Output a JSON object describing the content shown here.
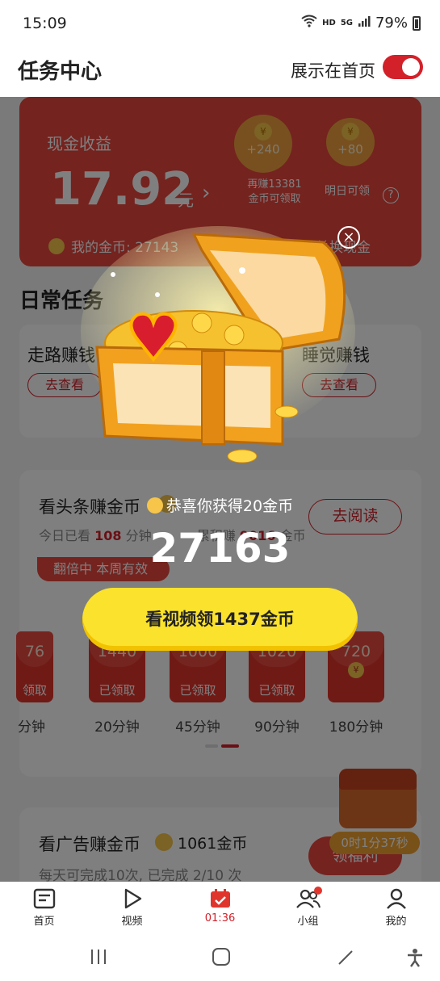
{
  "status_bar": {
    "time": "15:09",
    "network": "HD",
    "signal": "5G",
    "battery": "79%"
  },
  "header": {
    "title": "任务中心",
    "show_on_home_label": "展示在首页",
    "show_on_home_on": true
  },
  "cash_card": {
    "title": "现金收益",
    "amount": "17.92",
    "unit": "元",
    "badge_240": "+240",
    "earn_more": "再赚13381金币可领取",
    "badge_80": "+80",
    "tomorrow": "明日可领",
    "help": "?",
    "my_coins": "我的金币: 27143",
    "auto_exchange": "夜自动兑换现金"
  },
  "daily": {
    "title": "日常任务",
    "walk_title": "走路赚钱",
    "walk_btn": "去查看",
    "sleep_title": "睡觉赚钱",
    "sleep_btn": "去查看"
  },
  "read_card": {
    "title": "看头条赚金币",
    "go_btn": "去阅读",
    "today_label": "今日已看",
    "today_value": "108",
    "today_unit": "分钟",
    "total_label": "累积赚",
    "total_value": "9016",
    "total_unit": "金币",
    "double_tag": "翻倍中 本周有效",
    "envelopes": [
      {
        "value": "76",
        "label": "领取",
        "time": "分钟"
      },
      {
        "value": "1440",
        "label": "已领取",
        "time": "20分钟"
      },
      {
        "value": "1000",
        "label": "已领取",
        "time": "45分钟"
      },
      {
        "value": "1020",
        "label": "已领取",
        "time": "90分钟"
      },
      {
        "value": "720",
        "label": "¥",
        "time": "180分钟"
      }
    ]
  },
  "ad_card": {
    "title": "看广告赚金币",
    "coins": "1061金币",
    "sub": "每天可完成10次, 已完成 2/10 次",
    "welfare_btn": "领福利",
    "timer": "0时1分37秒"
  },
  "tabbar": [
    {
      "label": "首页",
      "icon": "doc-icon"
    },
    {
      "label": "视频",
      "icon": "play-icon"
    },
    {
      "label": "01:36",
      "icon": "calendar-icon"
    },
    {
      "label": "小组",
      "icon": "group-icon"
    },
    {
      "label": "我的",
      "icon": "person-icon"
    }
  ],
  "popup": {
    "reward_text": "恭喜你获得20金币",
    "total": "27163",
    "video_btn": "看视频领1437金币",
    "close": "×"
  },
  "colors": {
    "brand_red": "#e8463f",
    "button_yellow": "#fbe22c"
  }
}
